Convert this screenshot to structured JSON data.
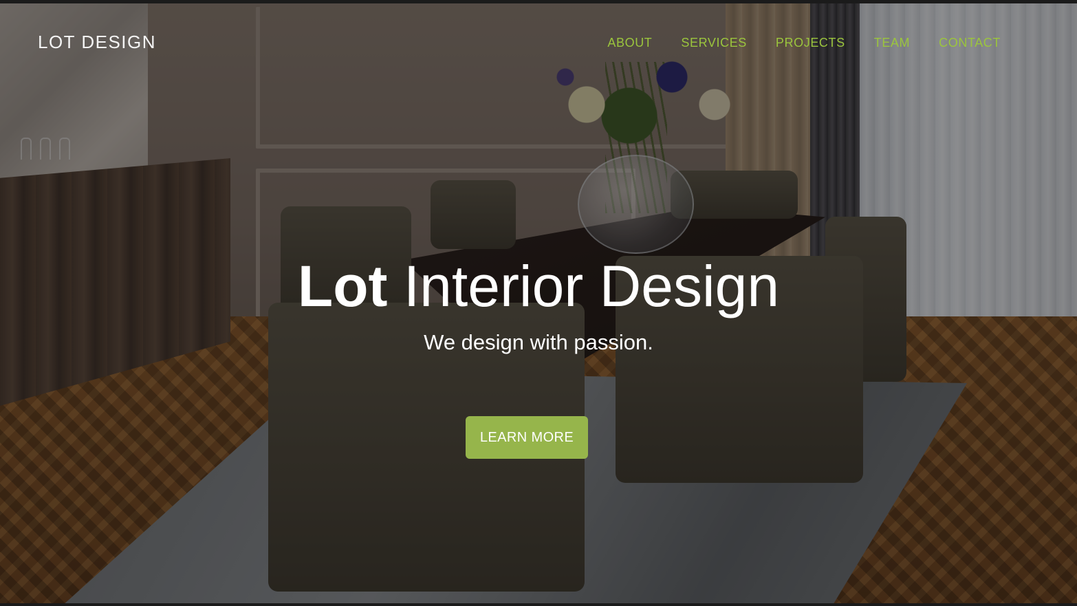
{
  "brand": {
    "name": "LOT DESIGN"
  },
  "nav": {
    "items": [
      {
        "label": "ABOUT"
      },
      {
        "label": "SERVICES"
      },
      {
        "label": "PROJECTS"
      },
      {
        "label": "TEAM"
      },
      {
        "label": "CONTACT"
      }
    ]
  },
  "hero": {
    "title_strong": "Lot",
    "title_rest": "Interior Design",
    "subtitle": "We design with passion.",
    "cta_label": "LEARN MORE",
    "background": "dimmed photo of a dining room with a dark table, upholstered chairs and a flower vase"
  },
  "colors": {
    "accent": "#96b54b",
    "nav_link": "#9bc53d",
    "text": "#ffffff"
  }
}
